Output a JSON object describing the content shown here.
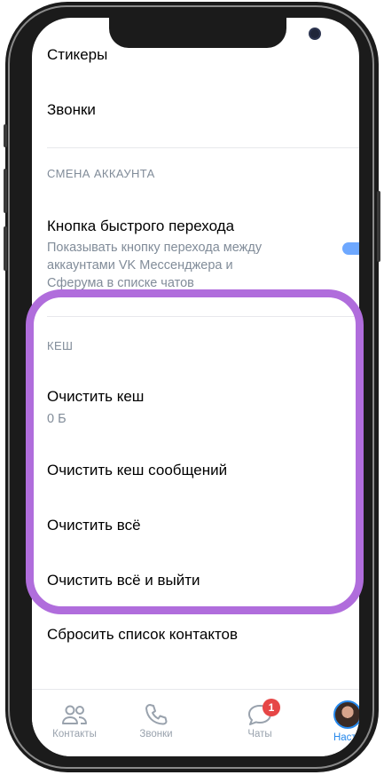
{
  "settings": {
    "stickers": "Стикеры",
    "calls": "Звонки",
    "account_section_header": "СМЕНА АККАУНТА",
    "quick_switch_title": "Кнопка быстрого перехода",
    "quick_switch_desc_1": "Показывать кнопку перехода между",
    "quick_switch_desc_2": "аккаунтами VK Мессенджера и",
    "quick_switch_desc_3": "Сферума в списке чатов",
    "quick_switch_enabled": true,
    "cache_section_header": "КЕШ",
    "clear_cache": "Очистить кеш",
    "cache_size": "0 Б",
    "clear_message_cache": "Очистить кеш сообщений",
    "clear_all": "Очистить всё",
    "clear_all_and_logout": "Очистить всё и выйти",
    "reset_contacts": "Сбросить список контактов"
  },
  "tabbar": {
    "contacts": "Контакты",
    "calls": "Звонки",
    "chats": "Чаты",
    "chats_badge": "1",
    "settings": "Настр"
  },
  "colors": {
    "accent": "#2688eb",
    "highlight": "#b06ddc",
    "badge": "#e64646",
    "secondary_text": "#818c99"
  }
}
